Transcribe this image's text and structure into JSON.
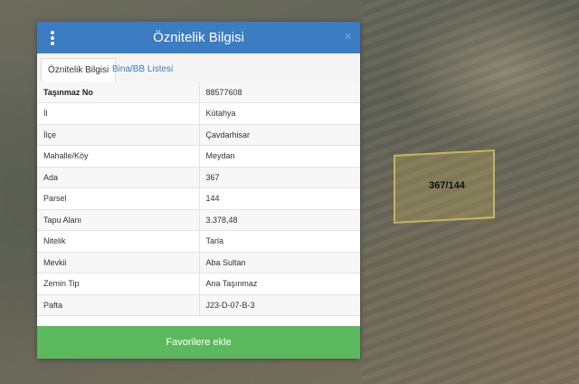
{
  "panel": {
    "title": "Öznitelik Bilgisi",
    "close_glyph": "×",
    "menu_icon": "more-vertical-icon",
    "tabs": [
      {
        "label": "Öznitelik Bilgisi",
        "active": true
      },
      {
        "label": "Bina/BB Listesi",
        "active": false
      }
    ],
    "rows": [
      {
        "key": "Taşınmaz No",
        "value": "88577608"
      },
      {
        "key": "İl",
        "value": "Kütahya"
      },
      {
        "key": "İlçe",
        "value": "Çavdarhisar"
      },
      {
        "key": "Mahalle/Köy",
        "value": "Meydan"
      },
      {
        "key": "Ada",
        "value": "367"
      },
      {
        "key": "Parsel",
        "value": "144"
      },
      {
        "key": "Tapu Alanı",
        "value": "3.378,48"
      },
      {
        "key": "Nitelik",
        "value": "Tarla"
      },
      {
        "key": "Mevkii",
        "value": "Aba Sultan"
      },
      {
        "key": "Zemin Tip",
        "value": "Ana Taşınmaz"
      },
      {
        "key": "Pafta",
        "value": "J23-D-07-B-3"
      }
    ],
    "favorite_button": "Favorilere ekle"
  },
  "map": {
    "parcel_label": "367/144"
  },
  "colors": {
    "header": "#3b7cc2",
    "button": "#5cb85c",
    "parcel_outline": "#d2be5a"
  }
}
